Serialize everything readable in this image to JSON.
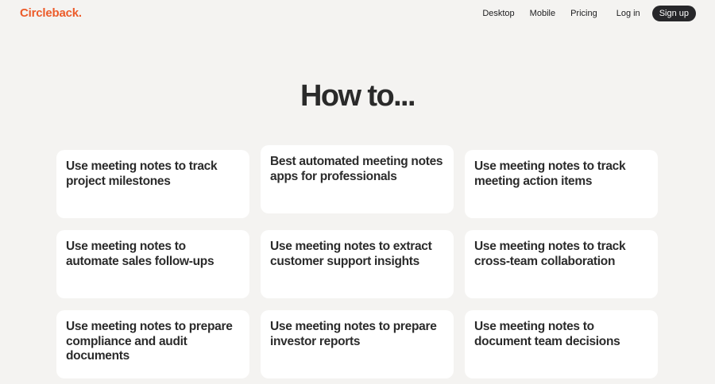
{
  "header": {
    "logo_text": "Circleback",
    "logo_dot": ".",
    "nav": {
      "desktop": "Desktop",
      "mobile": "Mobile",
      "pricing": "Pricing",
      "login": "Log in",
      "signup": "Sign up"
    }
  },
  "colors": {
    "brand": "#ec5b2a",
    "background": "#f4f3f1",
    "card": "#ffffff",
    "button": "#27272a"
  },
  "main": {
    "title": "How to...",
    "cards": [
      "Use meeting notes to track project milestones",
      "Best automated meeting notes apps for professionals",
      "Use meeting notes to track meeting action items",
      "Use meeting notes to automate sales follow-ups",
      "Use meeting notes to extract customer support insights",
      "Use meeting notes to track cross-team collaboration",
      "Use meeting notes to prepare compliance and audit documents",
      "Use meeting notes to prepare investor reports",
      "Use meeting notes to document team decisions"
    ]
  }
}
